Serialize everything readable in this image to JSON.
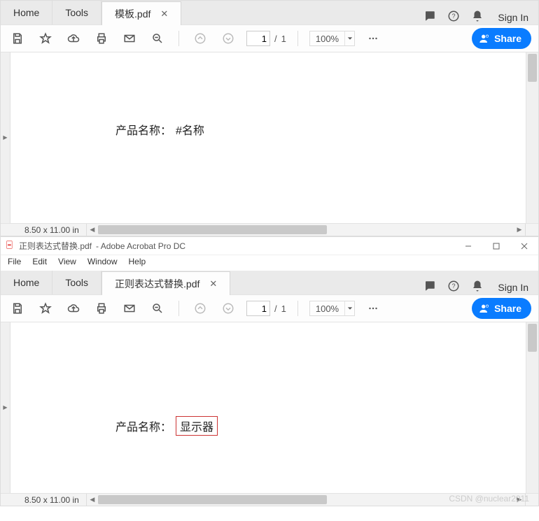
{
  "pane1": {
    "tabs": {
      "home": "Home",
      "tools": "Tools",
      "active_file": "模板.pdf"
    },
    "header_right": {
      "sign_in": "Sign In"
    },
    "toolbar": {
      "page_current": "1",
      "page_sep": "/",
      "page_total": "1",
      "zoom_value": "100%",
      "share_label": "Share"
    },
    "document": {
      "label": "产品名称：",
      "value": "#名称"
    },
    "status": {
      "dimensions": "8.50 x 11.00 in"
    }
  },
  "pane2": {
    "titlebar": {
      "filename": "正则表达式替换.pdf",
      "appname": "- Adobe Acrobat Pro DC"
    },
    "menubar": {
      "file": "File",
      "edit": "Edit",
      "view": "View",
      "window": "Window",
      "help": "Help"
    },
    "tabs": {
      "home": "Home",
      "tools": "Tools",
      "active_file": "正则表达式替换.pdf"
    },
    "header_right": {
      "sign_in": "Sign In"
    },
    "toolbar": {
      "page_current": "1",
      "page_sep": "/",
      "page_total": "1",
      "zoom_value": "100%",
      "share_label": "Share"
    },
    "document": {
      "label": "产品名称：",
      "value": "显示器"
    },
    "status": {
      "dimensions": "8.50 x 11.00 in"
    }
  },
  "watermark": "CSDN @nuclear2011",
  "icons": {
    "save": "save-icon",
    "star": "star-icon",
    "cloud": "cloud-upload-icon",
    "print": "printer-icon",
    "mail": "mail-icon",
    "search": "search-minus-icon",
    "up": "page-up-icon",
    "down": "page-down-icon",
    "overflow": "overflow-icon",
    "share_person": "person-plus-icon",
    "comment": "comment-icon",
    "help": "help-icon",
    "bell": "bell-icon",
    "min": "minimize-icon",
    "max": "maximize-icon",
    "close": "close-icon"
  }
}
